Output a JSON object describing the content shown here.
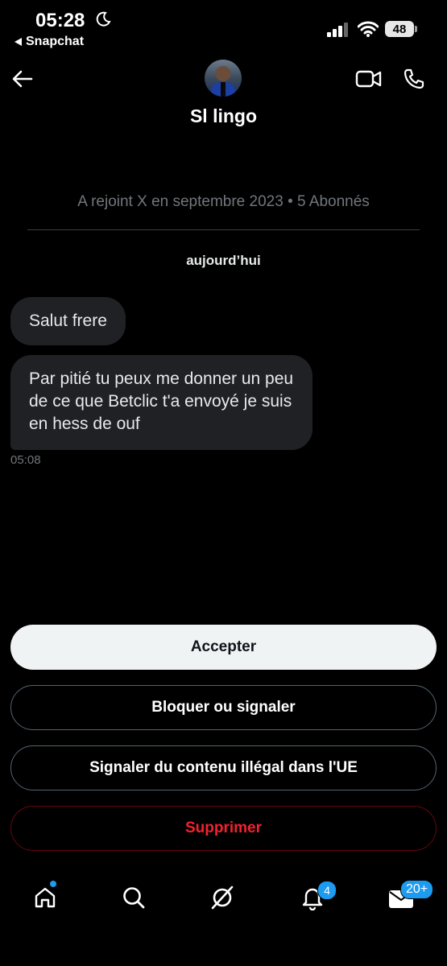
{
  "status_bar": {
    "time": "05:28",
    "back_app": "Snapchat",
    "battery": "48"
  },
  "header": {
    "profile_name": "Sl lingo"
  },
  "conversation": {
    "join_info": "A rejoint X en septembre 2023 • 5 Abonnés",
    "date_label": "aujourd’hui",
    "messages": [
      {
        "text": "Salut frere"
      },
      {
        "text": "Par pitié tu peux me donner un peu de ce que Betclic t'a envoyé je suis en hess de ouf"
      }
    ],
    "last_time": "05:08"
  },
  "actions": {
    "accept": "Accepter",
    "block": "Bloquer ou signaler",
    "report_eu": "Signaler du contenu illégal dans l'UE",
    "delete": "Supprimer"
  },
  "tab_bar": {
    "notifications_count": "4",
    "messages_count": "20+"
  },
  "icons": {
    "status": [
      "moon-icon",
      "back-triangle-icon",
      "signal-icon",
      "wifi-icon",
      "battery-icon"
    ],
    "header": [
      "back-arrow-icon",
      "video-icon",
      "phone-icon"
    ],
    "tabs": [
      "home-icon",
      "search-icon",
      "grok-icon",
      "bell-icon",
      "mail-icon"
    ]
  },
  "colors": {
    "background": "#000000",
    "bubble": "#1f2124",
    "accent": "#1d9bf0",
    "danger": "#f4212e",
    "muted": "#71767b"
  }
}
